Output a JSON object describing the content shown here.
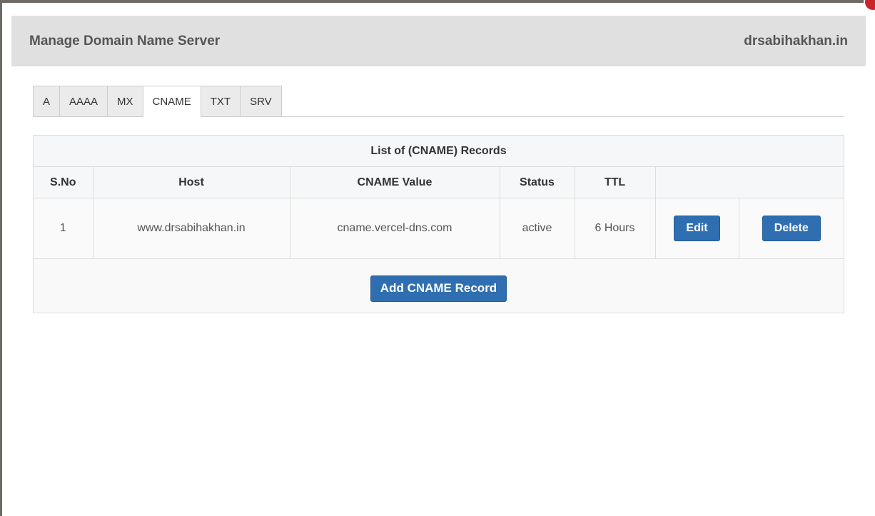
{
  "header": {
    "title": "Manage Domain Name Server",
    "domain": "drsabihakhan.in"
  },
  "tabs": [
    {
      "label": "A",
      "active": false
    },
    {
      "label": "AAAA",
      "active": false
    },
    {
      "label": "MX",
      "active": false
    },
    {
      "label": "CNAME",
      "active": true
    },
    {
      "label": "TXT",
      "active": false
    },
    {
      "label": "SRV",
      "active": false
    }
  ],
  "table": {
    "caption": "List of (CNAME) Records",
    "columns": [
      "S.No",
      "Host",
      "CNAME Value",
      "Status",
      "TTL"
    ],
    "rows": [
      {
        "sno": "1",
        "host": "www.drsabihakhan.in",
        "value": "cname.vercel-dns.com",
        "status": "active",
        "ttl": "6 Hours",
        "edit_label": "Edit",
        "delete_label": "Delete"
      }
    ]
  },
  "add_button_label": "Add CNAME Record",
  "colors": {
    "primary_button": "#2f6fb1",
    "header_bg": "#dfe0df",
    "close_badge": "#c9262b"
  }
}
